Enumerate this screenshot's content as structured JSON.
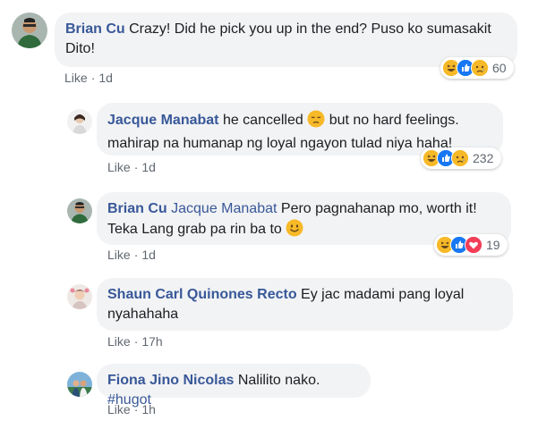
{
  "comments": [
    {
      "author": "Brian Cu",
      "text_line1": "Crazy! Did he pick you up in the end? Puso ko sumasakit",
      "text_line2": "Dito!",
      "like_label": "Like",
      "time": "1d",
      "reaction_count": "60",
      "reaction_icons": [
        "haha-icon",
        "like-icon",
        "sad-icon"
      ]
    },
    {
      "author": "Jacque Manabat",
      "text_part1": "he cancelled",
      "text_part2": "but no hard feelings.",
      "text_line2": "mahirap na humanap ng loyal ngayon tulad niya haha!",
      "like_label": "Like",
      "time": "1d",
      "reaction_count": "232",
      "reaction_icons": [
        "haha-icon",
        "like-icon",
        "sad-icon"
      ]
    },
    {
      "author": "Brian Cu",
      "mention": "Jacque Manabat",
      "text_part1": "Pero pagnahanap mo, worth it!",
      "text_line2": "Teka Lang grab pa rin ba to",
      "like_label": "Like",
      "time": "1d",
      "reaction_count": "19",
      "reaction_icons": [
        "haha-icon",
        "like-icon",
        "love-icon"
      ]
    },
    {
      "author": "Shaun Carl Quinones Recto",
      "text_part1": "Ey jac madami pang loyal",
      "text_line2": "nyahahaha",
      "like_label": "Like",
      "time": "17h"
    },
    {
      "author": "Fiona Jino Nicolas",
      "text_part1": "Nalilito nako.",
      "hashtag": "#hugot",
      "like_label": "Like",
      "time": "1h"
    }
  ],
  "colors": {
    "bubble": "#f2f3f5",
    "author": "#385898",
    "meta": "#606770",
    "like_blue": "#1877f2",
    "haha_yellow": "#f7b928",
    "love_red": "#f33e58"
  }
}
